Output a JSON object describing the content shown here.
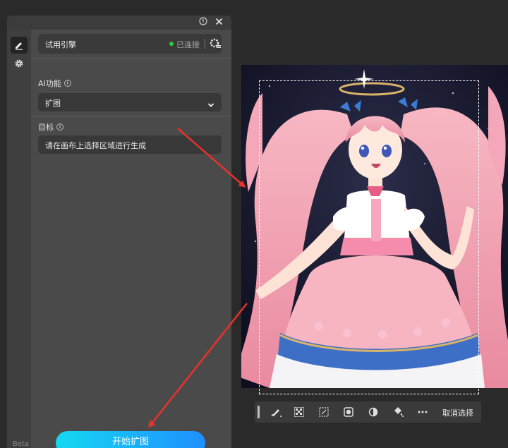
{
  "panel": {
    "engine_name": "试用引擎",
    "status_text": "已连接",
    "ai_function_label": "AI功能",
    "ai_function_value": "扩图",
    "target_label": "目标",
    "target_hint": "请在画布上选择区域进行生成",
    "start_button": "开始扩图",
    "beta_label": "Beta"
  },
  "toolbar": {
    "cancel_selection": "取消选择"
  },
  "colors": {
    "status_connected": "#2ecc40",
    "start_gradient_from": "#15d8f2",
    "start_gradient_to": "#1e8fff",
    "annotation_arrow": "#e8322b"
  },
  "icons": [
    "info-icon",
    "close-icon",
    "brush-icon",
    "gear-icon",
    "engine-settings-icon",
    "chevron-down-icon",
    "lasso-brush-icon",
    "checker-icon",
    "select-box-icon",
    "mask-icon",
    "invert-icon",
    "fill-icon",
    "more-icon"
  ]
}
